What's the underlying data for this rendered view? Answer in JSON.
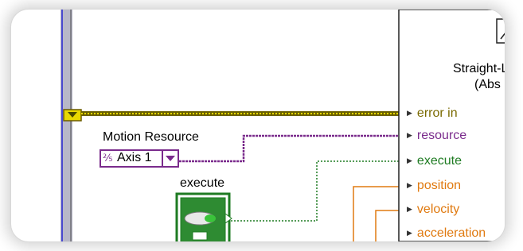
{
  "controls": {
    "motion_resource_label": "Motion Resource",
    "axis_value": "Axis 1",
    "axis_icon": "I/O-resource-icon",
    "execute_label": "execute"
  },
  "function_block": {
    "title_line1": "Straight-L",
    "title_line2": "(Abs",
    "terminals": [
      {
        "label": "error in",
        "color": "#7a6a00"
      },
      {
        "label": "resource",
        "color": "#7a2b8c"
      },
      {
        "label": "execute",
        "color": "#1e7b22"
      },
      {
        "label": "position",
        "color": "#e07a10"
      },
      {
        "label": "velocity",
        "color": "#e07a10"
      },
      {
        "label": "acceleration",
        "color": "#e07a10"
      }
    ]
  },
  "colors": {
    "error_wire": "#e8d800",
    "resource_wire": "#7a2b8c",
    "boolean_wire": "#1e7b22",
    "numeric_wire": "#e07a10",
    "loop_border": "#5a5a8a"
  }
}
